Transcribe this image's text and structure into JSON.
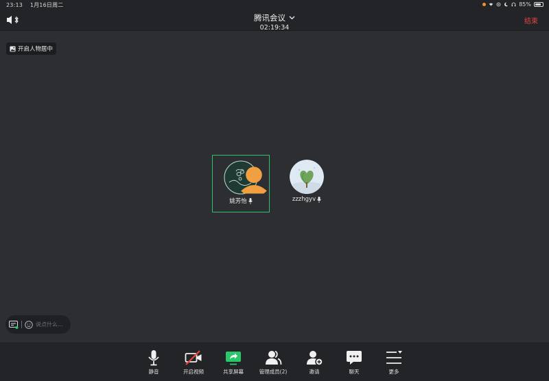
{
  "status_bar": {
    "time": "23:13",
    "date": "1月16日周二",
    "battery": "85%",
    "battery_level": 0.85
  },
  "header": {
    "title": "腾讯会议",
    "elapsed": "02:19:34",
    "end_label": "结束"
  },
  "portrait_badge": {
    "label": "开启人物居中"
  },
  "participants": [
    {
      "name": "姚芳怡",
      "active": true
    },
    {
      "name": "zzzhgyv",
      "active": false
    }
  ],
  "chat_bar": {
    "placeholder": "说点什么..."
  },
  "toolbar": {
    "mute": "静音",
    "video": "开启视频",
    "share": "共享屏幕",
    "members": "管理成员(2)",
    "invite": "邀请",
    "chat": "聊天",
    "more": "更多"
  },
  "colors": {
    "accent_green": "#2bc56a",
    "end_red": "#e4463c",
    "background": "#2c2e31",
    "bar": "#232427"
  }
}
